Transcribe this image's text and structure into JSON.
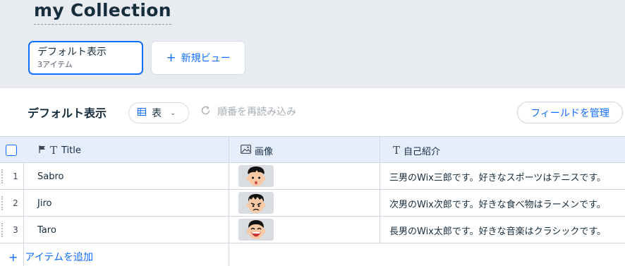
{
  "header": {
    "title": "my Collection"
  },
  "views": {
    "active": {
      "name": "デフォルト表示",
      "count": "3アイテム"
    },
    "new_view_label": "新規ビュー",
    "new_view_icon": "plus-icon"
  },
  "toolbar": {
    "view_title": "デフォルト表示",
    "layout_label": "表",
    "layout_icon": "table-icon",
    "reorder_label": "順番を再読み込み",
    "manage_fields_label": "フィールドを管理"
  },
  "table": {
    "columns": [
      {
        "label": "Title",
        "icon": "text-field-icon",
        "primary": true
      },
      {
        "label": "画像",
        "icon": "image-field-icon"
      },
      {
        "label": "自己紹介",
        "icon": "text-field-icon"
      }
    ],
    "rows": [
      {
        "num": "1",
        "title": "Sabro",
        "image": "face-surprised",
        "bio": "三男のWix三郎です。好きなスポーツはテニスです。"
      },
      {
        "num": "2",
        "title": "Jiro",
        "image": "face-frown",
        "bio": "次男のWix次郎です。好きな食べ物はラーメンです。"
      },
      {
        "num": "3",
        "title": "Taro",
        "image": "face-laugh",
        "bio": "長男のWix太郎です。好きな音楽はクラシックです。"
      }
    ],
    "add_item_label": "アイテムを追加"
  },
  "colors": {
    "accent": "#116dff",
    "header_bg": "#e8ebf0",
    "table_header_bg": "#e4eefc"
  }
}
